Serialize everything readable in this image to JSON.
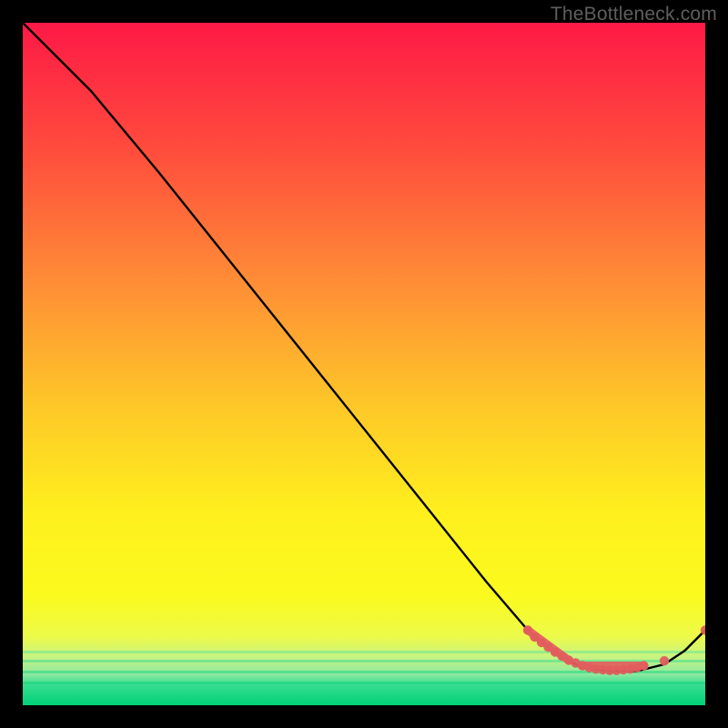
{
  "attribution": "TheBottleneck.com",
  "chart_data": {
    "type": "line",
    "title": "",
    "xlabel": "",
    "ylabel": "",
    "xlim": [
      0,
      100
    ],
    "ylim": [
      0,
      100
    ],
    "grid": false,
    "legend": false,
    "background_gradient": {
      "top": "#fe1946",
      "mid_upper": "#ff7d3b",
      "mid": "#fed629",
      "mid_lower": "#fbfa1e",
      "near_bottom": "#d9f863",
      "bottom_band": "#00d77a",
      "band_start_y": 91
    },
    "series": [
      {
        "name": "curve",
        "type": "line",
        "color": "#000000",
        "x": [
          0,
          3,
          6,
          10,
          15,
          20,
          28,
          36,
          44,
          52,
          60,
          68,
          74,
          78,
          82,
          86,
          90,
          94,
          97,
          100
        ],
        "y": [
          100,
          97,
          94,
          90,
          84,
          78,
          68,
          58,
          48,
          38,
          28,
          18,
          11,
          7.5,
          5.5,
          5,
          5,
          6,
          8,
          11
        ]
      },
      {
        "name": "markers-cluster",
        "type": "scatter",
        "color": "#e25e5e",
        "x": [
          74,
          75,
          76,
          77,
          78,
          79,
          80,
          81,
          82,
          83,
          84,
          85,
          86,
          87,
          88,
          89,
          90,
          91,
          94,
          100
        ],
        "y": [
          11,
          10,
          9.2,
          8.5,
          7.8,
          7.2,
          6.6,
          6.2,
          5.8,
          5.5,
          5.3,
          5.2,
          5.1,
          5.1,
          5.2,
          5.3,
          5.5,
          5.8,
          6.5,
          11
        ]
      },
      {
        "name": "markers-segments",
        "type": "line-segments",
        "color": "#e25e5e",
        "segments": [
          {
            "x": [
              74,
              80
            ],
            "y": [
              11,
              6.6
            ]
          },
          {
            "x": [
              82,
              91
            ],
            "y": [
              5.8,
              5.8
            ]
          }
        ]
      }
    ]
  }
}
